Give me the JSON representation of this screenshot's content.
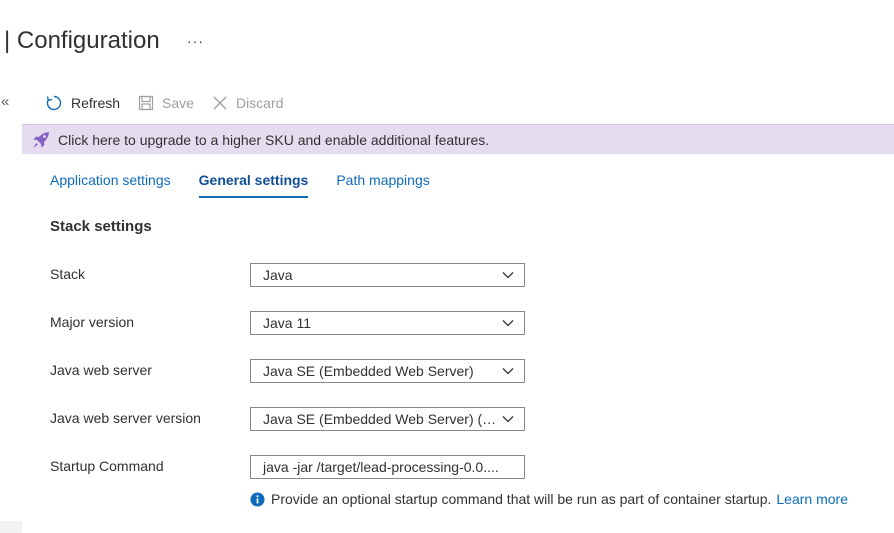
{
  "header": {
    "title": "| Configuration",
    "more_label": "···"
  },
  "nav": {
    "collapse_label": "«"
  },
  "toolbar": {
    "refresh_label": "Refresh",
    "save_label": "Save",
    "discard_label": "Discard"
  },
  "banner": {
    "text": "Click here to upgrade to a higher SKU and enable additional features."
  },
  "tabs": [
    {
      "label": "Application settings"
    },
    {
      "label": "General settings"
    },
    {
      "label": "Path mappings"
    }
  ],
  "stack_settings": {
    "title": "Stack settings",
    "rows": [
      {
        "label": "Stack",
        "value": "Java"
      },
      {
        "label": "Major version",
        "value": "Java 11"
      },
      {
        "label": "Java web server",
        "value": "Java SE (Embedded Web Server)"
      },
      {
        "label": "Java web server version",
        "value": "Java SE (Embedded Web Server) (aut..."
      }
    ],
    "startup": {
      "label": "Startup Command",
      "value": "java -jar /target/lead-processing-0.0...."
    },
    "info": {
      "text": "Provide an optional startup command that will be run as part of container startup.",
      "link": "Learn more"
    }
  },
  "colors": {
    "accent": "#0f6cbd",
    "banner_bg": "#e6dcef",
    "rocket": "#8661c5"
  }
}
